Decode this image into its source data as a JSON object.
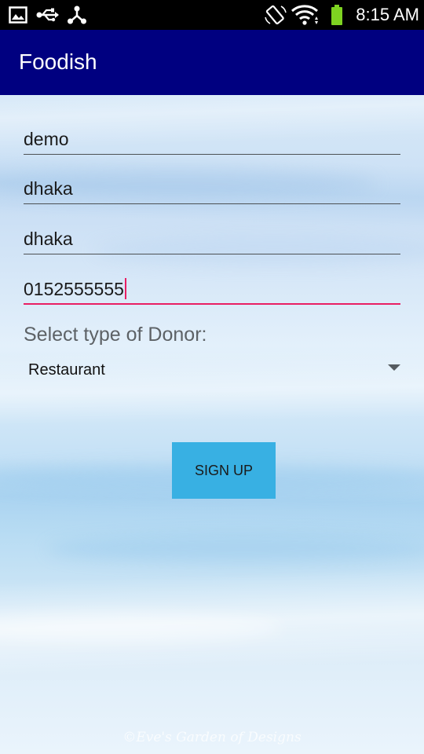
{
  "status_bar": {
    "time": "8:15 AM",
    "left_icons": [
      "image-icon",
      "usb-icon",
      "share-icon"
    ],
    "right_icons": [
      "screen-rotation-icon",
      "wifi-icon",
      "battery-icon"
    ],
    "battery_color": "#7ed321"
  },
  "app_bar": {
    "title": "Foodish",
    "color": "#000080"
  },
  "form": {
    "fields": [
      {
        "value": "demo"
      },
      {
        "value": "dhaka"
      },
      {
        "value": "dhaka"
      },
      {
        "value": "0152555555",
        "focused": true
      }
    ],
    "donor_label": "Select type of Donor:",
    "donor_type_selected": "Restaurant",
    "signup_label": "SIGN UP",
    "accent_color": "#e91e63",
    "button_color": "#38b0e3"
  },
  "background": {
    "watermark": "©Eve's Garden of Designs"
  }
}
